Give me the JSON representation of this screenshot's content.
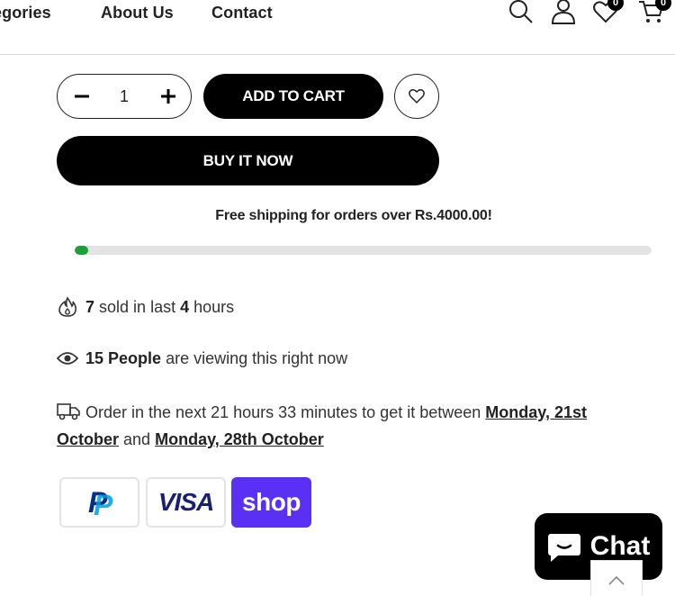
{
  "header": {
    "nav": [
      "egories",
      "About Us",
      "Contact"
    ],
    "wishlist_count": "0",
    "cart_count": "0"
  },
  "product": {
    "quantity": "1",
    "add_to_cart_label": "ADD TO CART",
    "buy_now_label": "BUY IT NOW"
  },
  "shipping": {
    "text": "Free shipping for orders over Rs.4000.00!",
    "progress_percent": 1.2,
    "progress_color": "#1ba13a"
  },
  "stats": {
    "sold_count": "7",
    "sold_text": "sold in last",
    "sold_hours": "4",
    "sold_unit": "hours",
    "viewing_people": "15 People",
    "viewing_text": "are viewing this right now"
  },
  "delivery": {
    "prefix": "Order in the next 21 hours 33 minutes to get it between",
    "start_date": "Monday, 21st October",
    "joiner": "and",
    "end_date": "Monday, 28th October"
  },
  "payments": {
    "paypal": "P",
    "visa": "VISA",
    "shop": "shop",
    "shop_color": "#5a31f4"
  },
  "chat": {
    "label": "Chat"
  }
}
